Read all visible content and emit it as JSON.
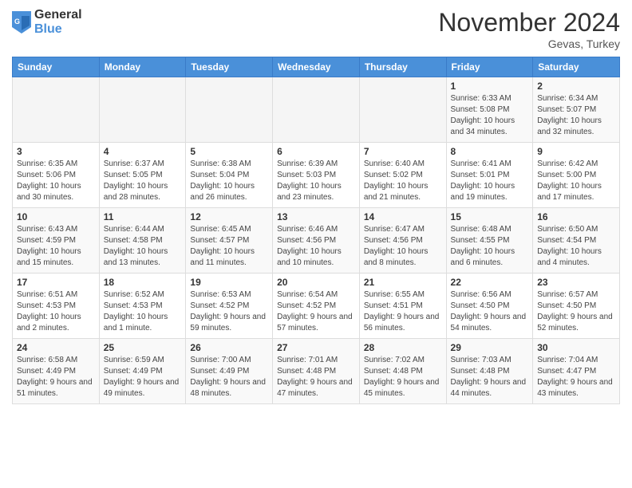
{
  "logo": {
    "general": "General",
    "blue": "Blue"
  },
  "header": {
    "title": "November 2024",
    "location": "Gevas, Turkey"
  },
  "days_of_week": [
    "Sunday",
    "Monday",
    "Tuesday",
    "Wednesday",
    "Thursday",
    "Friday",
    "Saturday"
  ],
  "weeks": [
    [
      {
        "day": "",
        "info": ""
      },
      {
        "day": "",
        "info": ""
      },
      {
        "day": "",
        "info": ""
      },
      {
        "day": "",
        "info": ""
      },
      {
        "day": "",
        "info": ""
      },
      {
        "day": "1",
        "info": "Sunrise: 6:33 AM\nSunset: 5:08 PM\nDaylight: 10 hours and 34 minutes."
      },
      {
        "day": "2",
        "info": "Sunrise: 6:34 AM\nSunset: 5:07 PM\nDaylight: 10 hours and 32 minutes."
      }
    ],
    [
      {
        "day": "3",
        "info": "Sunrise: 6:35 AM\nSunset: 5:06 PM\nDaylight: 10 hours and 30 minutes."
      },
      {
        "day": "4",
        "info": "Sunrise: 6:37 AM\nSunset: 5:05 PM\nDaylight: 10 hours and 28 minutes."
      },
      {
        "day": "5",
        "info": "Sunrise: 6:38 AM\nSunset: 5:04 PM\nDaylight: 10 hours and 26 minutes."
      },
      {
        "day": "6",
        "info": "Sunrise: 6:39 AM\nSunset: 5:03 PM\nDaylight: 10 hours and 23 minutes."
      },
      {
        "day": "7",
        "info": "Sunrise: 6:40 AM\nSunset: 5:02 PM\nDaylight: 10 hours and 21 minutes."
      },
      {
        "day": "8",
        "info": "Sunrise: 6:41 AM\nSunset: 5:01 PM\nDaylight: 10 hours and 19 minutes."
      },
      {
        "day": "9",
        "info": "Sunrise: 6:42 AM\nSunset: 5:00 PM\nDaylight: 10 hours and 17 minutes."
      }
    ],
    [
      {
        "day": "10",
        "info": "Sunrise: 6:43 AM\nSunset: 4:59 PM\nDaylight: 10 hours and 15 minutes."
      },
      {
        "day": "11",
        "info": "Sunrise: 6:44 AM\nSunset: 4:58 PM\nDaylight: 10 hours and 13 minutes."
      },
      {
        "day": "12",
        "info": "Sunrise: 6:45 AM\nSunset: 4:57 PM\nDaylight: 10 hours and 11 minutes."
      },
      {
        "day": "13",
        "info": "Sunrise: 6:46 AM\nSunset: 4:56 PM\nDaylight: 10 hours and 10 minutes."
      },
      {
        "day": "14",
        "info": "Sunrise: 6:47 AM\nSunset: 4:56 PM\nDaylight: 10 hours and 8 minutes."
      },
      {
        "day": "15",
        "info": "Sunrise: 6:48 AM\nSunset: 4:55 PM\nDaylight: 10 hours and 6 minutes."
      },
      {
        "day": "16",
        "info": "Sunrise: 6:50 AM\nSunset: 4:54 PM\nDaylight: 10 hours and 4 minutes."
      }
    ],
    [
      {
        "day": "17",
        "info": "Sunrise: 6:51 AM\nSunset: 4:53 PM\nDaylight: 10 hours and 2 minutes."
      },
      {
        "day": "18",
        "info": "Sunrise: 6:52 AM\nSunset: 4:53 PM\nDaylight: 10 hours and 1 minute."
      },
      {
        "day": "19",
        "info": "Sunrise: 6:53 AM\nSunset: 4:52 PM\nDaylight: 9 hours and 59 minutes."
      },
      {
        "day": "20",
        "info": "Sunrise: 6:54 AM\nSunset: 4:52 PM\nDaylight: 9 hours and 57 minutes."
      },
      {
        "day": "21",
        "info": "Sunrise: 6:55 AM\nSunset: 4:51 PM\nDaylight: 9 hours and 56 minutes."
      },
      {
        "day": "22",
        "info": "Sunrise: 6:56 AM\nSunset: 4:50 PM\nDaylight: 9 hours and 54 minutes."
      },
      {
        "day": "23",
        "info": "Sunrise: 6:57 AM\nSunset: 4:50 PM\nDaylight: 9 hours and 52 minutes."
      }
    ],
    [
      {
        "day": "24",
        "info": "Sunrise: 6:58 AM\nSunset: 4:49 PM\nDaylight: 9 hours and 51 minutes."
      },
      {
        "day": "25",
        "info": "Sunrise: 6:59 AM\nSunset: 4:49 PM\nDaylight: 9 hours and 49 minutes."
      },
      {
        "day": "26",
        "info": "Sunrise: 7:00 AM\nSunset: 4:49 PM\nDaylight: 9 hours and 48 minutes."
      },
      {
        "day": "27",
        "info": "Sunrise: 7:01 AM\nSunset: 4:48 PM\nDaylight: 9 hours and 47 minutes."
      },
      {
        "day": "28",
        "info": "Sunrise: 7:02 AM\nSunset: 4:48 PM\nDaylight: 9 hours and 45 minutes."
      },
      {
        "day": "29",
        "info": "Sunrise: 7:03 AM\nSunset: 4:48 PM\nDaylight: 9 hours and 44 minutes."
      },
      {
        "day": "30",
        "info": "Sunrise: 7:04 AM\nSunset: 4:47 PM\nDaylight: 9 hours and 43 minutes."
      }
    ]
  ]
}
